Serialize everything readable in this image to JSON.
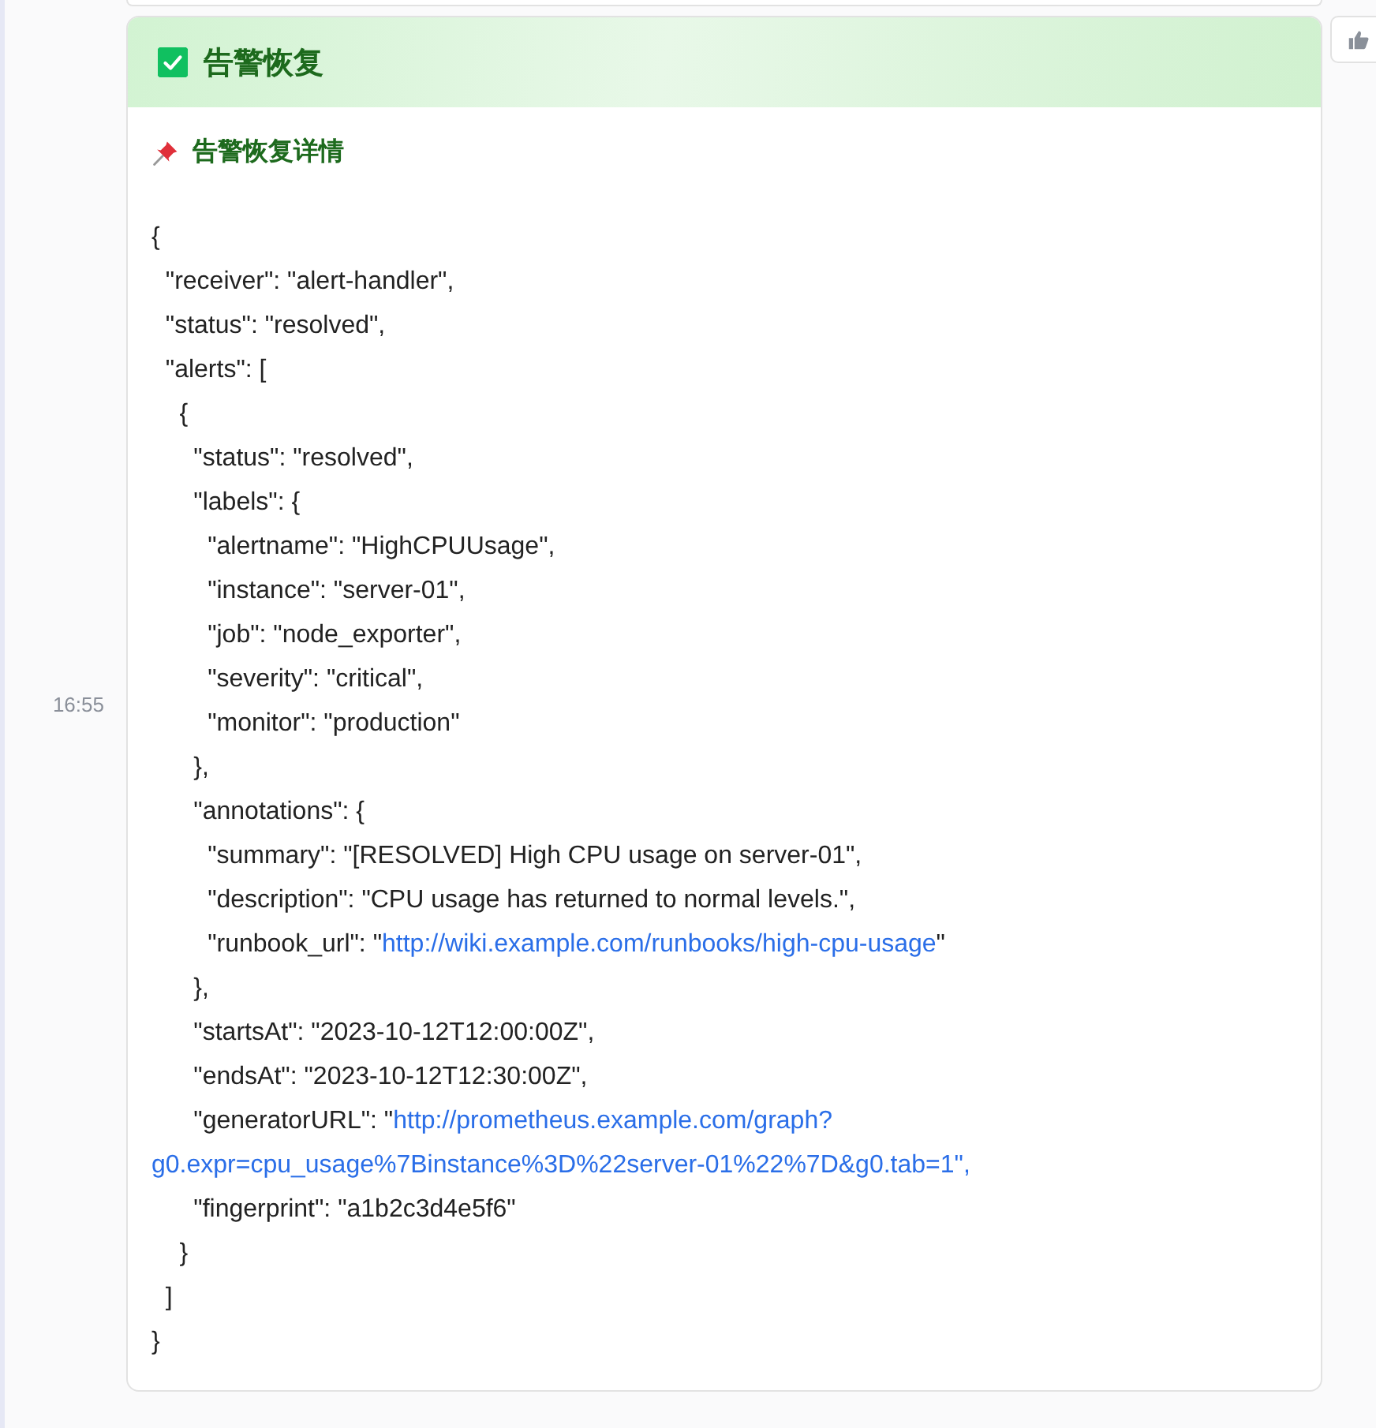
{
  "message": {
    "time": "16:55",
    "title": "告警恢复",
    "checked": true,
    "section_title": "告警恢复详情",
    "lines": [
      {
        "text": "{"
      },
      {
        "text": "  \"receiver\": \"alert-handler\","
      },
      {
        "text": "  \"status\": \"resolved\","
      },
      {
        "text": "  \"alerts\": ["
      },
      {
        "text": "    {"
      },
      {
        "text": "      \"status\": \"resolved\","
      },
      {
        "text": "      \"labels\": {"
      },
      {
        "text": "        \"alertname\": \"HighCPUUsage\","
      },
      {
        "text": "        \"instance\": \"server-01\","
      },
      {
        "text": "        \"job\": \"node_exporter\","
      },
      {
        "text": "        \"severity\": \"critical\","
      },
      {
        "text": "        \"monitor\": \"production\""
      },
      {
        "text": "      },"
      },
      {
        "text": "      \"annotations\": {"
      },
      {
        "text": "        \"summary\": \"[RESOLVED] High CPU usage on server-01\","
      },
      {
        "text": "        \"description\": \"CPU usage has returned to normal levels.\","
      },
      {
        "text": "        \"runbook_url\": \"",
        "link": "http://wiki.example.com/runbooks/high-cpu-usage",
        "tail": "\""
      },
      {
        "text": "      },"
      },
      {
        "text": "      \"startsAt\": \"2023-10-12T12:00:00Z\","
      },
      {
        "text": "      \"endsAt\": \"2023-10-12T12:30:00Z\","
      },
      {
        "text": "      \"generatorURL\": \"",
        "link": "http://prometheus.example.com/graph?"
      },
      {
        "link": "g0.expr=cpu_usage%7Binstance%3D%22server-01%22%7D&g0.tab=1\","
      },
      {
        "text": "      \"fingerprint\": \"a1b2c3d4e5f6\""
      },
      {
        "text": "    }"
      },
      {
        "text": "  ]"
      },
      {
        "text": "}"
      }
    ]
  }
}
